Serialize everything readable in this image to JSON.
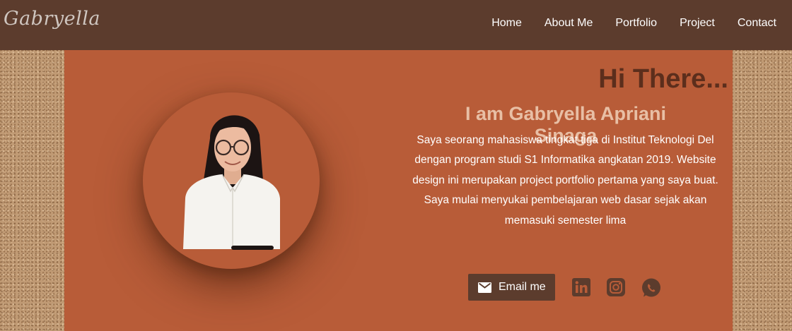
{
  "nav": {
    "brand": "Gabryella",
    "links": [
      "Home",
      "About Me",
      "Portfolio",
      "Project",
      "Contact"
    ]
  },
  "hero": {
    "greeting": "Hi There...",
    "name": "I am Gabryella Apriani Sinaga",
    "bio": "Saya seorang mahasiswa tingkat tiga di Institut Teknologi Del dengan program studi S1 Informatika angkatan 2019. Website design ini merupakan project portfolio pertama yang saya buat. Saya mulai menyukai pembelajaran web dasar sejak akan memasuki semester lima",
    "email_label": "Email me",
    "social": [
      "linkedin-icon",
      "instagram-icon",
      "whatsapp-icon"
    ]
  },
  "colors": {
    "navbar": "#5c3c2d",
    "panel": "#b85c38",
    "greeting": "#5c2e1c",
    "name": "#e8bfa5",
    "button": "#5c3c2d"
  }
}
